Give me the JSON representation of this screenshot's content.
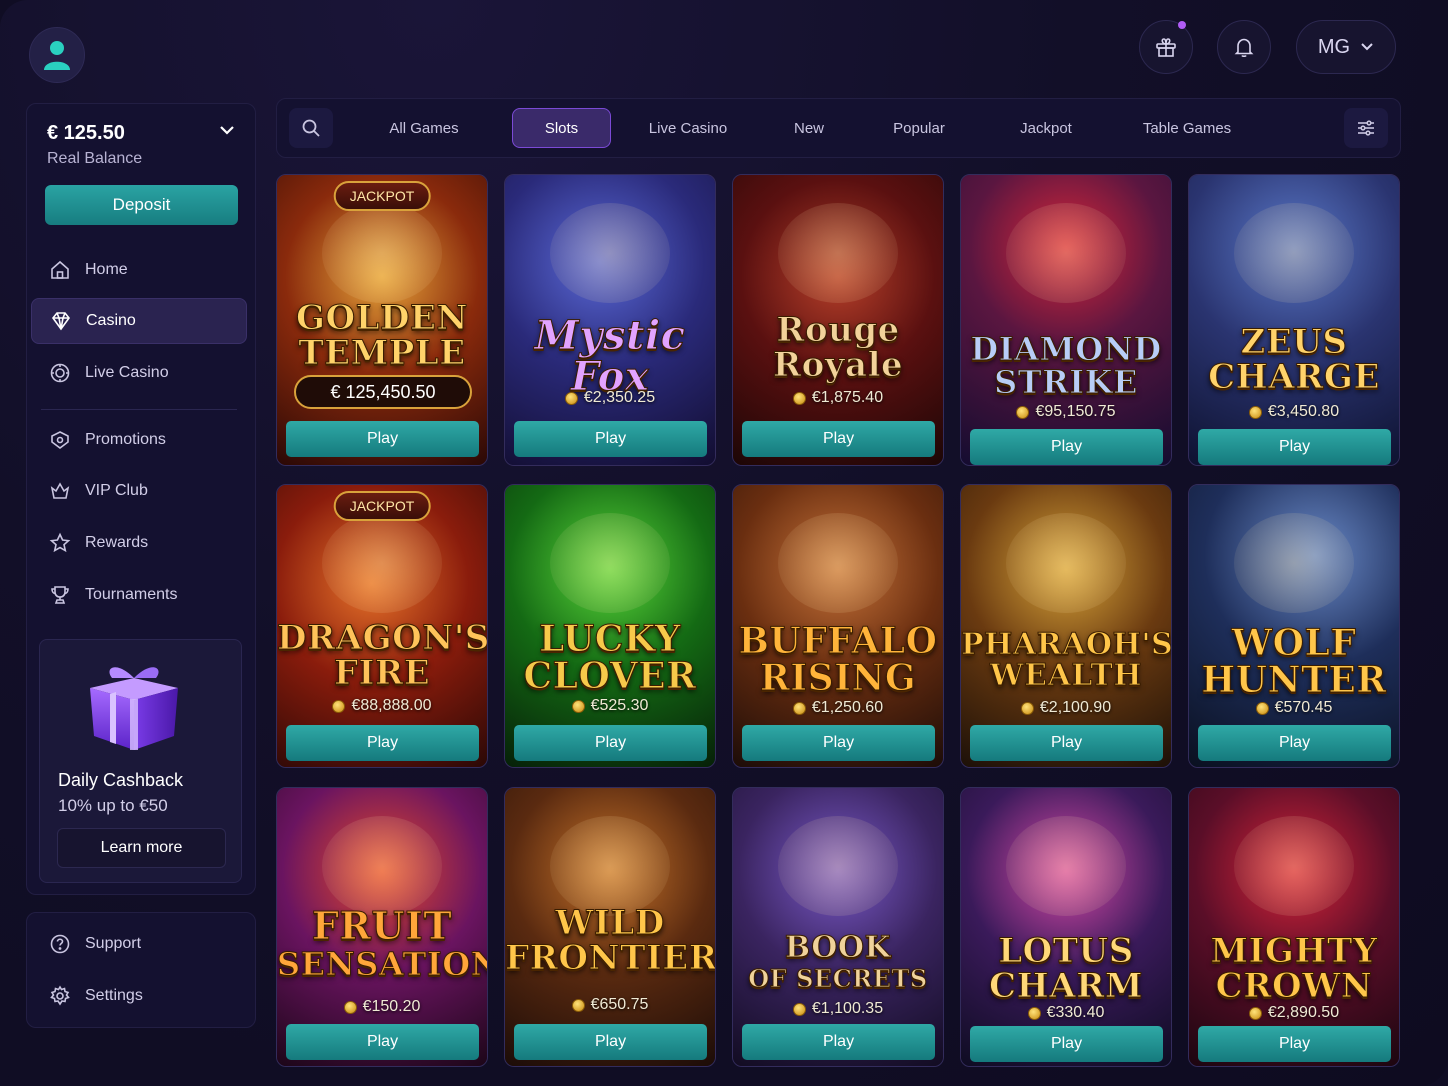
{
  "header": {
    "user_initials": "MG",
    "icons": [
      "user-icon",
      "gift-icon",
      "bell-icon",
      "chevron-down-icon"
    ]
  },
  "sidebar": {
    "balance": "€ 125.50",
    "balance_label": "Real Balance",
    "deposit_label": "Deposit",
    "items": [
      {
        "label": "Home",
        "icon": "home-icon"
      },
      {
        "label": "Casino",
        "icon": "diamond-icon"
      },
      {
        "label": "Live Casino",
        "icon": "chip-icon"
      },
      {
        "label": "Promotions",
        "icon": "tag-icon"
      },
      {
        "label": "VIP Club",
        "icon": "crown-icon"
      },
      {
        "label": "Rewards",
        "icon": "star-icon"
      },
      {
        "label": "Tournaments",
        "icon": "trophy-icon"
      }
    ],
    "promo": {
      "title": "Daily Cashback",
      "subtitle": "10% up to €50",
      "button": "Learn more"
    },
    "bottom_items": [
      {
        "label": "Support",
        "icon": "support-icon"
      },
      {
        "label": "Settings",
        "icon": "gear-icon"
      }
    ]
  },
  "tabs": [
    "All Games",
    "Slots",
    "Live Casino",
    "New",
    "Popular",
    "Jackpot",
    "Table Games"
  ],
  "active_tab": "Slots",
  "colors": {
    "accent_teal": "#1f9797",
    "active_purple": "#7b4ad6",
    "background": "#100d24"
  },
  "games": [
    {
      "line1": "GOLDEN",
      "line2": "TEMPLE",
      "badge": "JACKPOT",
      "jackpot": "€ 125,450.50",
      "play": "Play"
    },
    {
      "line1": "Mystic",
      "line2": "Fox",
      "amount": "€2,350.25",
      "play": "Play"
    },
    {
      "line1": "Rouge",
      "line2": "Royale",
      "amount": "€1,875.40",
      "play": "Play"
    },
    {
      "line1": "DIAMOND",
      "line2": "STRIKE",
      "amount": "€95,150.75",
      "play": "Play"
    },
    {
      "line1": "ZEUS",
      "line2": "CHARGE",
      "amount": "€3,450.80",
      "play": "Play"
    },
    {
      "line1": "DRAGON'S",
      "line2": "FIRE",
      "badge": "JACKPOT",
      "amount": "€88,888.00",
      "play": "Play"
    },
    {
      "line1": "LUCKY",
      "line2": "CLOVER",
      "amount": "€525.30",
      "play": "Play"
    },
    {
      "line1": "BUFFALO",
      "line2": "RISING",
      "amount": "€1,250.60",
      "play": "Play"
    },
    {
      "line1": "PHARAOH'S",
      "line2": "WEALTH",
      "amount": "€2,100.90",
      "play": "Play"
    },
    {
      "line1": "WOLF",
      "line2": "HUNTER",
      "amount": "€570.45",
      "play": "Play"
    },
    {
      "line1": "FRUIT",
      "line2": "SENSATION",
      "amount": "€150.20",
      "play": "Play"
    },
    {
      "line1": "WILD",
      "line2": "FRONTIER",
      "amount": "€650.75",
      "play": "Play"
    },
    {
      "line1": "BOOK",
      "line2": "OF SECRETS",
      "amount": "€1,100.35",
      "play": "Play"
    },
    {
      "line1": "LOTUS",
      "line2": "CHARM",
      "amount": "€330.40",
      "play": "Play"
    },
    {
      "line1": "MIGHTY",
      "line2": "CROWN",
      "amount": "€2,890.50",
      "play": "Play"
    }
  ]
}
